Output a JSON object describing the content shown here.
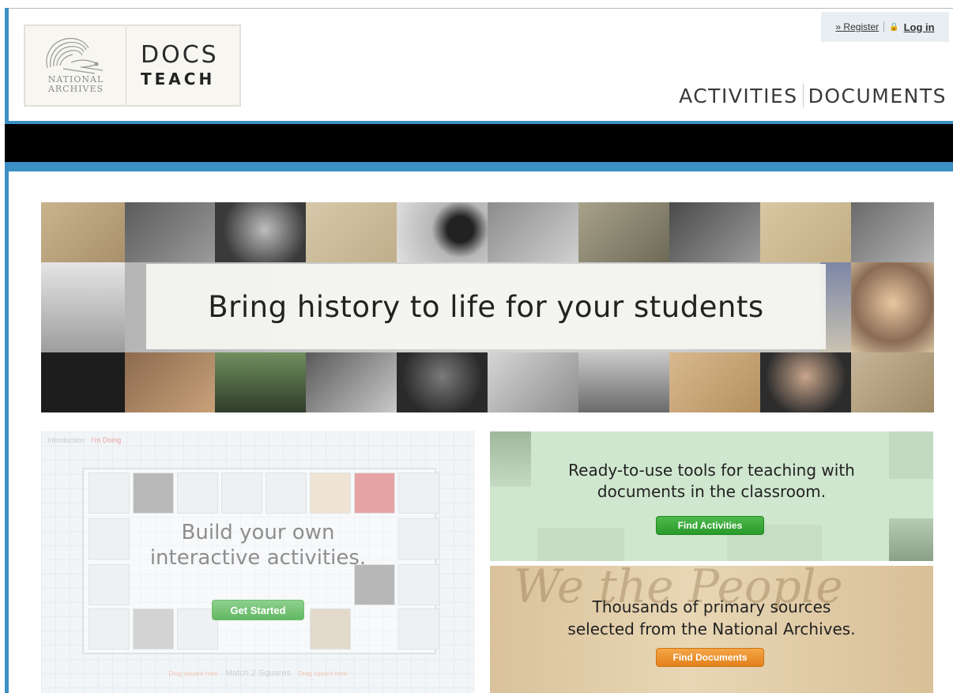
{
  "header": {
    "logo": {
      "seal_text_line1": "NATIONAL",
      "seal_text_line2": "ARCHIVES",
      "docs": "DOCS",
      "teach": "TEACH"
    },
    "auth": {
      "register": "» Register",
      "login": "Log in",
      "lock_icon": "lock-icon"
    },
    "nav": [
      {
        "label": "ACTIVITIES"
      },
      {
        "label": "DOCUMENTS"
      }
    ]
  },
  "hero": {
    "title": "Bring history to life for your students"
  },
  "build": {
    "breadcrumb_intro": "Introduction",
    "breadcrumb_active": "I'm Doing",
    "title_line1": "Build your own",
    "title_line2": "interactive activities.",
    "button": "Get Started",
    "match_label": "Match 2 Squares",
    "drag_label": "Drag square here"
  },
  "activities": {
    "line1": "Ready-to-use tools for teaching with",
    "line2": "documents in the classroom.",
    "button": "Find Activities"
  },
  "documents": {
    "line1": "Thousands of primary sources",
    "line2": "selected from the National Archives.",
    "button": "Find Documents",
    "bg_script": "We the People"
  },
  "colors": {
    "accent_blue": "#3b8fc4",
    "green_button": "#2a9a2a",
    "orange_button": "#e2801c"
  }
}
